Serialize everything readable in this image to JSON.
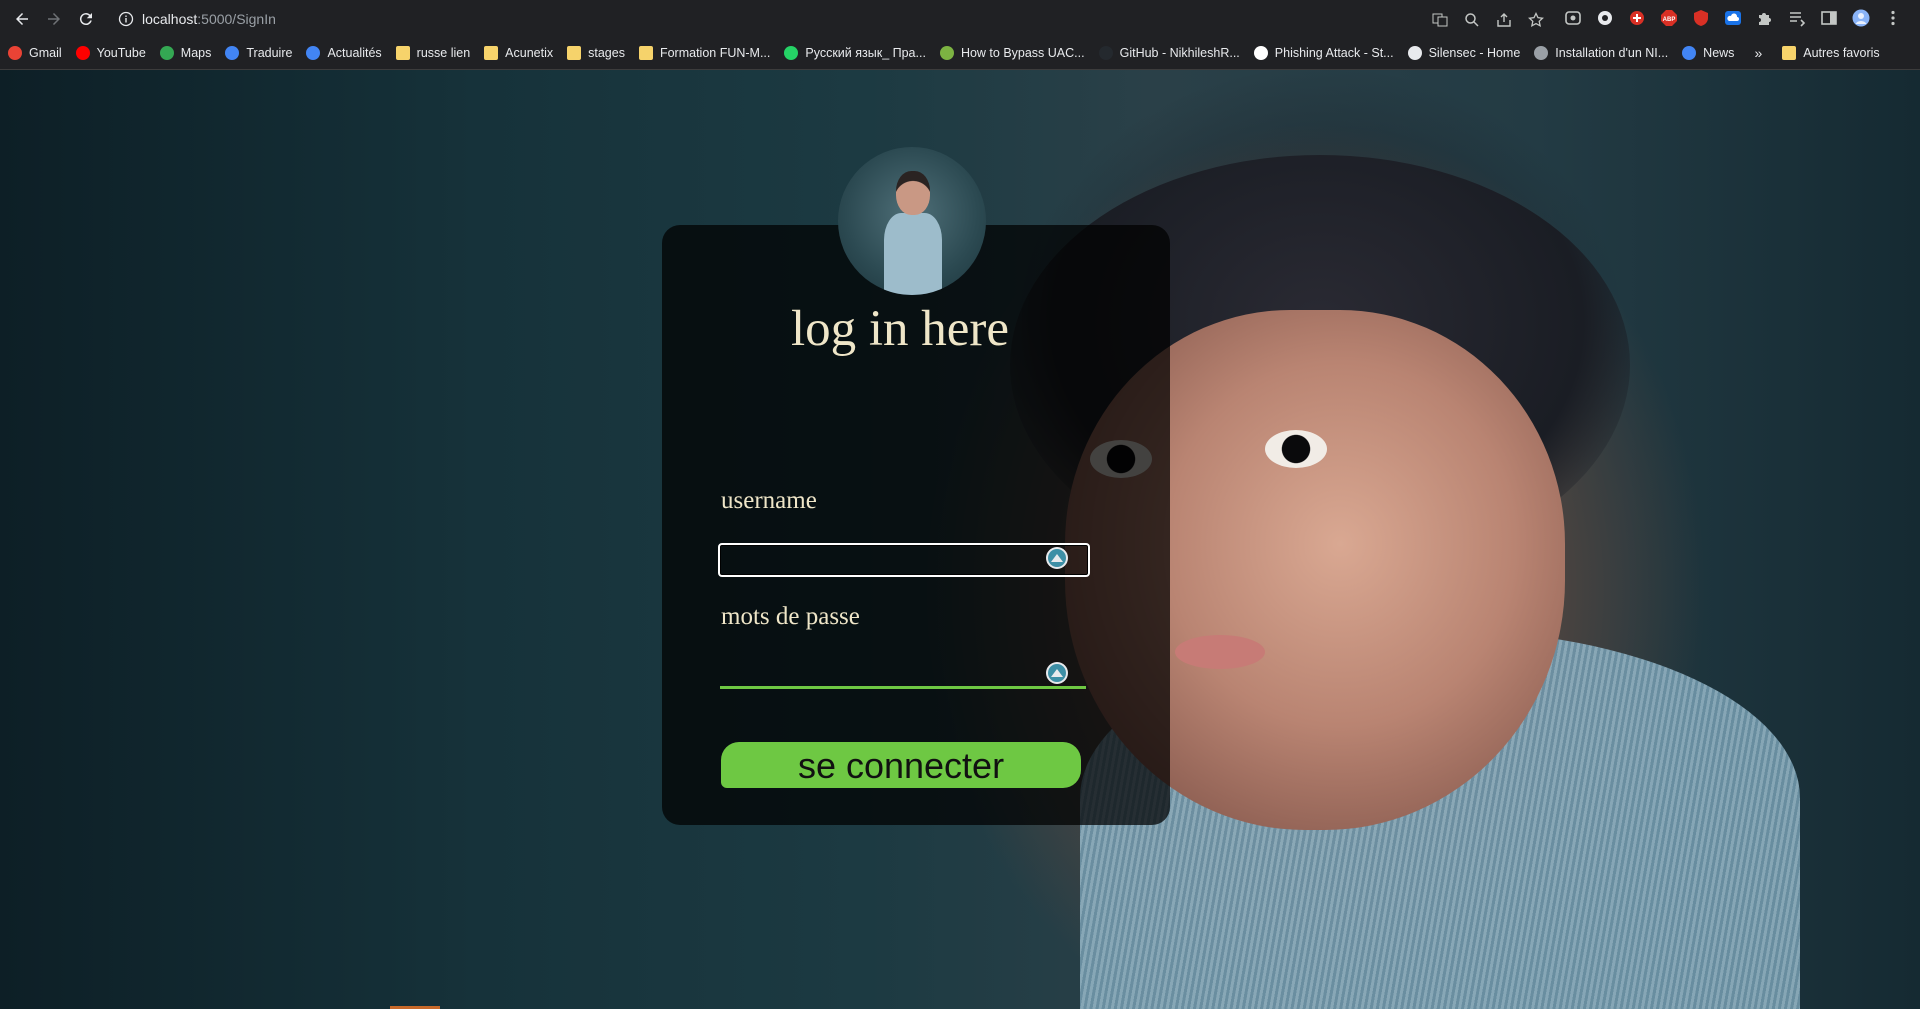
{
  "browser": {
    "url_host": "localhost",
    "url_path": ":5000/SignIn"
  },
  "bookmarks": [
    {
      "label": "Gmail",
      "icon": "gmail-icon",
      "color": "#ea4335"
    },
    {
      "label": "YouTube",
      "icon": "youtube-icon",
      "color": "#ff0000"
    },
    {
      "label": "Maps",
      "icon": "maps-pin-icon",
      "color": "#34a853"
    },
    {
      "label": "Traduire",
      "icon": "translate-icon",
      "color": "#4285f4"
    },
    {
      "label": "Actualités",
      "icon": "news-icon",
      "color": "#4285f4"
    },
    {
      "label": "russe lien",
      "icon": "folder-icon",
      "color": "#f6d36b"
    },
    {
      "label": "Acunetix",
      "icon": "folder-icon",
      "color": "#f6d36b"
    },
    {
      "label": "stages",
      "icon": "folder-icon",
      "color": "#f6d36b"
    },
    {
      "label": "Formation FUN-M...",
      "icon": "folder-icon",
      "color": "#f6d36b"
    },
    {
      "label": "Русский язык_ Пра...",
      "icon": "whatsapp-icon",
      "color": "#25d366"
    },
    {
      "label": "How to Bypass UAC...",
      "icon": "android-icon",
      "color": "#7cb342"
    },
    {
      "label": "GitHub - NikhileshR...",
      "icon": "github-icon",
      "color": "#24292e"
    },
    {
      "label": "Phishing Attack - St...",
      "icon": "g-icon",
      "color": "#ffffff"
    },
    {
      "label": "Silensec - Home",
      "icon": "globe-icon",
      "color": "#e8eaed"
    },
    {
      "label": "Installation d'un NI...",
      "icon": "terminal-icon",
      "color": "#9aa0a6"
    },
    {
      "label": "News",
      "icon": "news-icon",
      "color": "#4285f4"
    }
  ],
  "bookmarks_overflow": "»",
  "other_bookmarks": {
    "label": "Autres favoris",
    "icon": "folder-icon",
    "color": "#f6d36b"
  },
  "form": {
    "title": "log in here",
    "username_label": "username",
    "username_value": "",
    "password_label": "mots de passe",
    "password_value": "",
    "submit_label": "se connecter"
  },
  "colors": {
    "accent": "#6ec843",
    "title_text": "#efe6c8"
  }
}
